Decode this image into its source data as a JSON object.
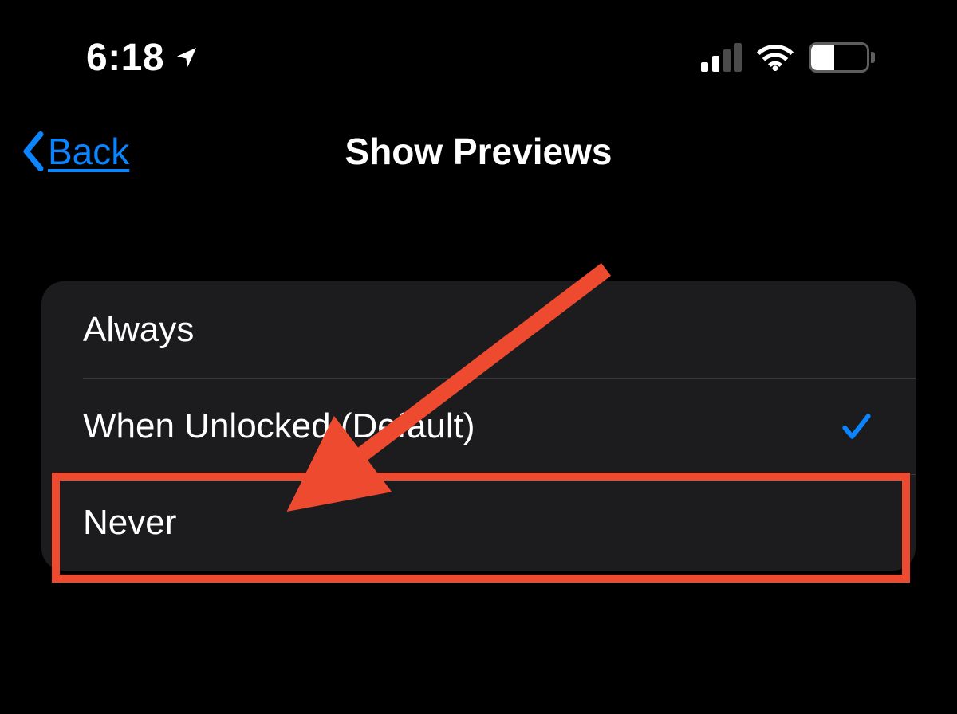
{
  "status": {
    "time": "6:18",
    "battery_percent": "42"
  },
  "nav": {
    "back_label": "Back",
    "title": "Show Previews"
  },
  "options": {
    "always": "Always",
    "when_unlocked": "When Unlocked (Default)",
    "never": "Never",
    "selected_index": 1
  },
  "colors": {
    "accent": "#0a84ff",
    "annotation": "#ed4a2f"
  }
}
